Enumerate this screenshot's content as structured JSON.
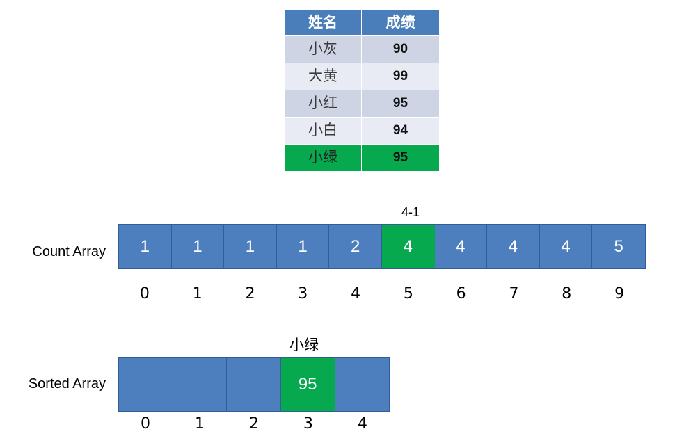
{
  "score_table": {
    "headers": [
      "姓名",
      "成绩"
    ],
    "rows": [
      {
        "name": "小灰",
        "score": "90",
        "highlight": false
      },
      {
        "name": "大黄",
        "score": "99",
        "highlight": false
      },
      {
        "name": "小红",
        "score": "95",
        "highlight": false
      },
      {
        "name": "小白",
        "score": "94",
        "highlight": false
      },
      {
        "name": "小绿",
        "score": "95",
        "highlight": true
      }
    ]
  },
  "count_array": {
    "label": "Count Array",
    "values": [
      "1",
      "1",
      "1",
      "1",
      "2",
      "4",
      "4",
      "4",
      "4",
      "5"
    ],
    "indices": [
      "0",
      "1",
      "2",
      "3",
      "4",
      "5",
      "6",
      "7",
      "8",
      "9"
    ],
    "highlight_index": 5,
    "note": "4-1"
  },
  "sorted_array": {
    "label": "Sorted Array",
    "values": [
      "",
      "",
      "",
      "95",
      ""
    ],
    "indices": [
      "0",
      "1",
      "2",
      "3",
      "4"
    ],
    "highlight_index": 3,
    "note": "小绿"
  },
  "colors": {
    "header_blue": "#4a7ebb",
    "cell_blue": "#4d7fbe",
    "cell_border": "#2f5f96",
    "highlight_green": "#07a94e",
    "band_dark": "#ced4e4",
    "band_light": "#e8ebf3",
    "background": "#ffffff"
  }
}
